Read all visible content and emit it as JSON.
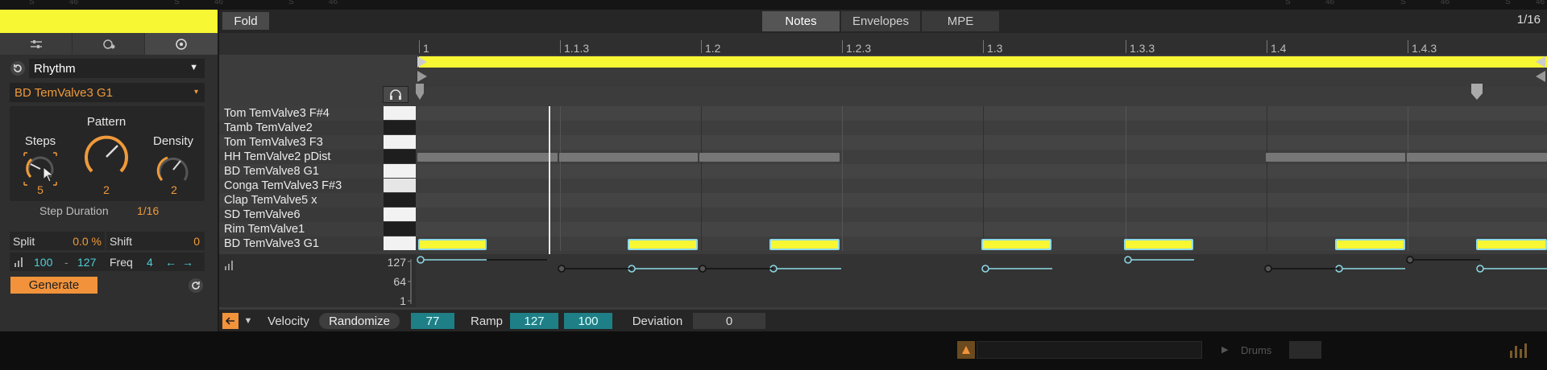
{
  "topbar": {
    "labels": [
      "S",
      "46",
      "S",
      "46",
      "S",
      "46",
      "S",
      "46",
      "S",
      "46",
      "S",
      "46"
    ]
  },
  "left_panel": {
    "tabs": [
      "mixer-icon",
      "macro-icon",
      "groove-icon"
    ],
    "generator": "Rhythm",
    "target": "BD TemValve3 G1",
    "knobs": {
      "steps": {
        "label": "Steps",
        "value": "5"
      },
      "pattern": {
        "label": "Pattern",
        "value": "2"
      },
      "density": {
        "label": "Density",
        "value": "2"
      }
    },
    "step_duration": {
      "label": "Step Duration",
      "value": "1/16"
    },
    "split": {
      "label": "Split",
      "value": "0.0 %"
    },
    "shift": {
      "label": "Shift",
      "value": "0"
    },
    "velocity_range": {
      "low": "100",
      "high": "127"
    },
    "freq": {
      "label": "Freq",
      "value": "4"
    },
    "generate_label": "Generate"
  },
  "editor": {
    "fold_label": "Fold",
    "tabs": [
      {
        "label": "Notes",
        "active": true
      },
      {
        "label": "Envelopes"
      },
      {
        "label": "MPE"
      }
    ],
    "grid_label": "1/16",
    "ruler": [
      "1",
      "1.1.3",
      "1.2",
      "1.2.3",
      "1.3",
      "1.3.3",
      "1.4",
      "1.4.3"
    ],
    "lanes": [
      "Tom TemValve3 F#4",
      "Tamb TemValve2",
      "Tom TemValve3 F3",
      "HH TemValve2 pDist",
      "BD TemValve8 G1",
      "Conga TemValve3 F#3",
      "Clap TemValve5 x",
      "SD TemValve6",
      "Rim TemValve1",
      "BD TemValve3 G1"
    ],
    "velocity_axis": [
      "127",
      "64",
      "1"
    ]
  },
  "bottom_bar": {
    "velocity_label": "Velocity",
    "randomize_label": "Randomize",
    "randomize_value": "77",
    "ramp_label": "Ramp",
    "ramp_start": "127",
    "ramp_end": "100",
    "deviation_label": "Deviation",
    "deviation_value": "0"
  },
  "footer": {
    "track_label": "Drums"
  },
  "colors": {
    "accent": "#ef9a3b",
    "clip": "#f7f733",
    "note_border": "#8ed9e6",
    "teal": "#1f7f86"
  }
}
